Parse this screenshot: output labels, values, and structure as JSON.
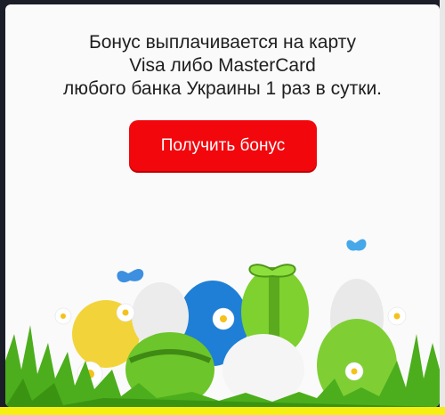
{
  "bonus": {
    "line1": "Бонус выплачивается на карту",
    "line2": "Visa либо MasterCard",
    "line3": "любого банка Украины 1 раз в сутки."
  },
  "cta": {
    "label": "Получить бонус"
  },
  "colors": {
    "button": "#f2070d",
    "bottom_bar": "#f5ef12",
    "background": "#1b1d28"
  }
}
